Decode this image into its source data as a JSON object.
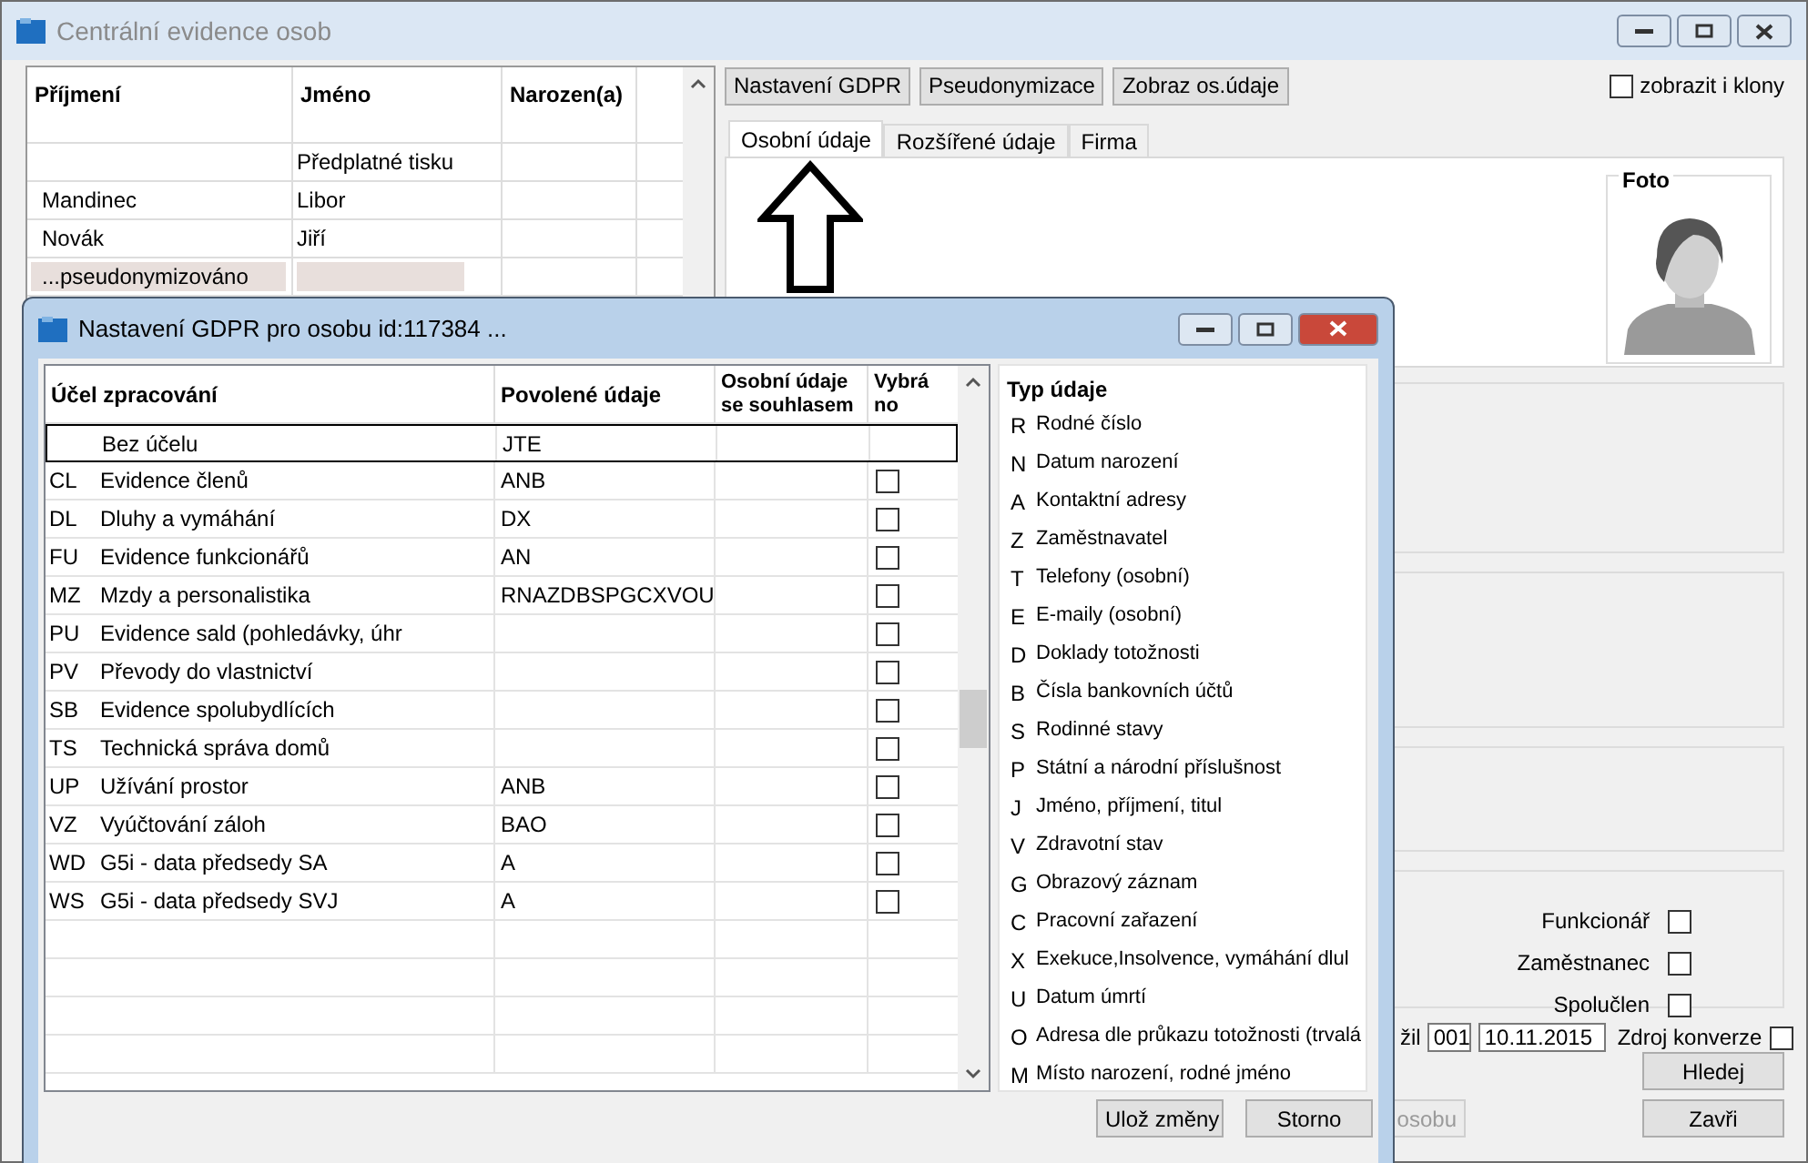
{
  "window": {
    "title": "Centrální evidence osob"
  },
  "people_grid": {
    "columns": [
      "Příjmení",
      "Jméno",
      "Narozen(a)"
    ],
    "rows": [
      {
        "surname": "",
        "name": "Předplatné tisku",
        "pseudonymized": false
      },
      {
        "surname": "Mandinec",
        "name": "Libor",
        "pseudonymized": false
      },
      {
        "surname": "Novák",
        "name": "Jiří",
        "pseudonymized": false
      },
      {
        "surname": "...pseudonymizováno",
        "name": "",
        "pseudonymized": true
      }
    ]
  },
  "toolbar": {
    "buttons": [
      "Nastavení GDPR",
      "Pseudonymizace",
      "Zobraz os.údaje"
    ],
    "clones_checkbox": {
      "label": "zobrazit i klony",
      "checked": false
    }
  },
  "tabs": [
    {
      "label": "Osobní údaje",
      "selected": true
    },
    {
      "label": "Rozšířené údaje",
      "selected": false
    },
    {
      "label": "Firma",
      "selected": false
    }
  ],
  "photo": {
    "label": "Foto"
  },
  "flags": [
    {
      "label": "Funkcionář",
      "checked": false
    },
    {
      "label": "Zaměstnanec",
      "checked": false
    },
    {
      "label": "Spolučlen",
      "checked": false
    }
  ],
  "bottom_row": {
    "label_fragment": "žil",
    "code": "001",
    "date": "10.11.2015",
    "conversion": {
      "label": "Zdroj konverze",
      "checked": false
    }
  },
  "main_buttons": {
    "search": "Hledej",
    "person_fragment": "osobu",
    "close": "Zavři"
  },
  "dialog": {
    "title": "Nastavení GDPR pro osobu id:117384 ...",
    "columns": [
      "Účel zpracování",
      "Povolené údaje",
      "Osobní údaje se souhlasem",
      "Vybráno"
    ],
    "rows": [
      {
        "code": "",
        "purpose": "Bez účelu",
        "allowed": "JTE",
        "selected": true
      },
      {
        "code": "CL",
        "purpose": "Evidence členů",
        "allowed": "ANB",
        "checked": false,
        "selected": false
      },
      {
        "code": "DL",
        "purpose": "Dluhy a vymáhání",
        "allowed": "DX",
        "checked": false,
        "selected": false
      },
      {
        "code": "FU",
        "purpose": "Evidence funkcionářů",
        "allowed": "AN",
        "checked": false,
        "selected": false
      },
      {
        "code": "MZ",
        "purpose": "Mzdy a personalistika",
        "allowed": "RNAZDBSPGCXVOU",
        "checked": false,
        "selected": false
      },
      {
        "code": "PU",
        "purpose": "Evidence sald (pohledávky, úhr",
        "allowed": "",
        "checked": false,
        "selected": false
      },
      {
        "code": "PV",
        "purpose": "Převody do vlastnictví",
        "allowed": "",
        "checked": false,
        "selected": false
      },
      {
        "code": "SB",
        "purpose": "Evidence spolubydlících",
        "allowed": "",
        "checked": false,
        "selected": false
      },
      {
        "code": "TS",
        "purpose": "Technická správa domů",
        "allowed": "",
        "checked": false,
        "selected": false
      },
      {
        "code": "UP",
        "purpose": "Užívání prostor",
        "allowed": "ANB",
        "checked": false,
        "selected": false
      },
      {
        "code": "VZ",
        "purpose": "Vyúčtování záloh",
        "allowed": "BAO",
        "checked": false,
        "selected": false
      },
      {
        "code": "WD",
        "purpose": "G5i - data předsedy SA",
        "allowed": "A",
        "checked": false,
        "selected": false
      },
      {
        "code": "WS",
        "purpose": "G5i - data předsedy SVJ",
        "allowed": "A",
        "checked": false,
        "selected": false
      }
    ],
    "types_header": "Typ údaje",
    "types": [
      {
        "code": "R",
        "label": "Rodné číslo"
      },
      {
        "code": "N",
        "label": "Datum narození"
      },
      {
        "code": "A",
        "label": "Kontaktní adresy"
      },
      {
        "code": "Z",
        "label": "Zaměstnavatel"
      },
      {
        "code": "T",
        "label": "Telefony (osobní)"
      },
      {
        "code": "E",
        "label": "E-maily (osobní)"
      },
      {
        "code": "D",
        "label": "Doklady totožnosti"
      },
      {
        "code": "B",
        "label": "Čísla bankovních účtů"
      },
      {
        "code": "S",
        "label": "Rodinné stavy"
      },
      {
        "code": "P",
        "label": "Státní a národní příslušnost"
      },
      {
        "code": "J",
        "label": "Jméno, příjmení, titul"
      },
      {
        "code": "V",
        "label": "Zdravotní stav"
      },
      {
        "code": "G",
        "label": "Obrazový záznam"
      },
      {
        "code": "C",
        "label": "Pracovní zařazení"
      },
      {
        "code": "X",
        "label": "Exekuce,Insolvence, vymáhání dlul"
      },
      {
        "code": "U",
        "label": "Datum úmrtí"
      },
      {
        "code": "O",
        "label": "Adresa dle průkazu totožnosti (trvalá"
      },
      {
        "code": "M",
        "label": "Místo narození, rodné jméno"
      }
    ],
    "buttons": [
      "Ulož změny",
      "Storno"
    ]
  }
}
